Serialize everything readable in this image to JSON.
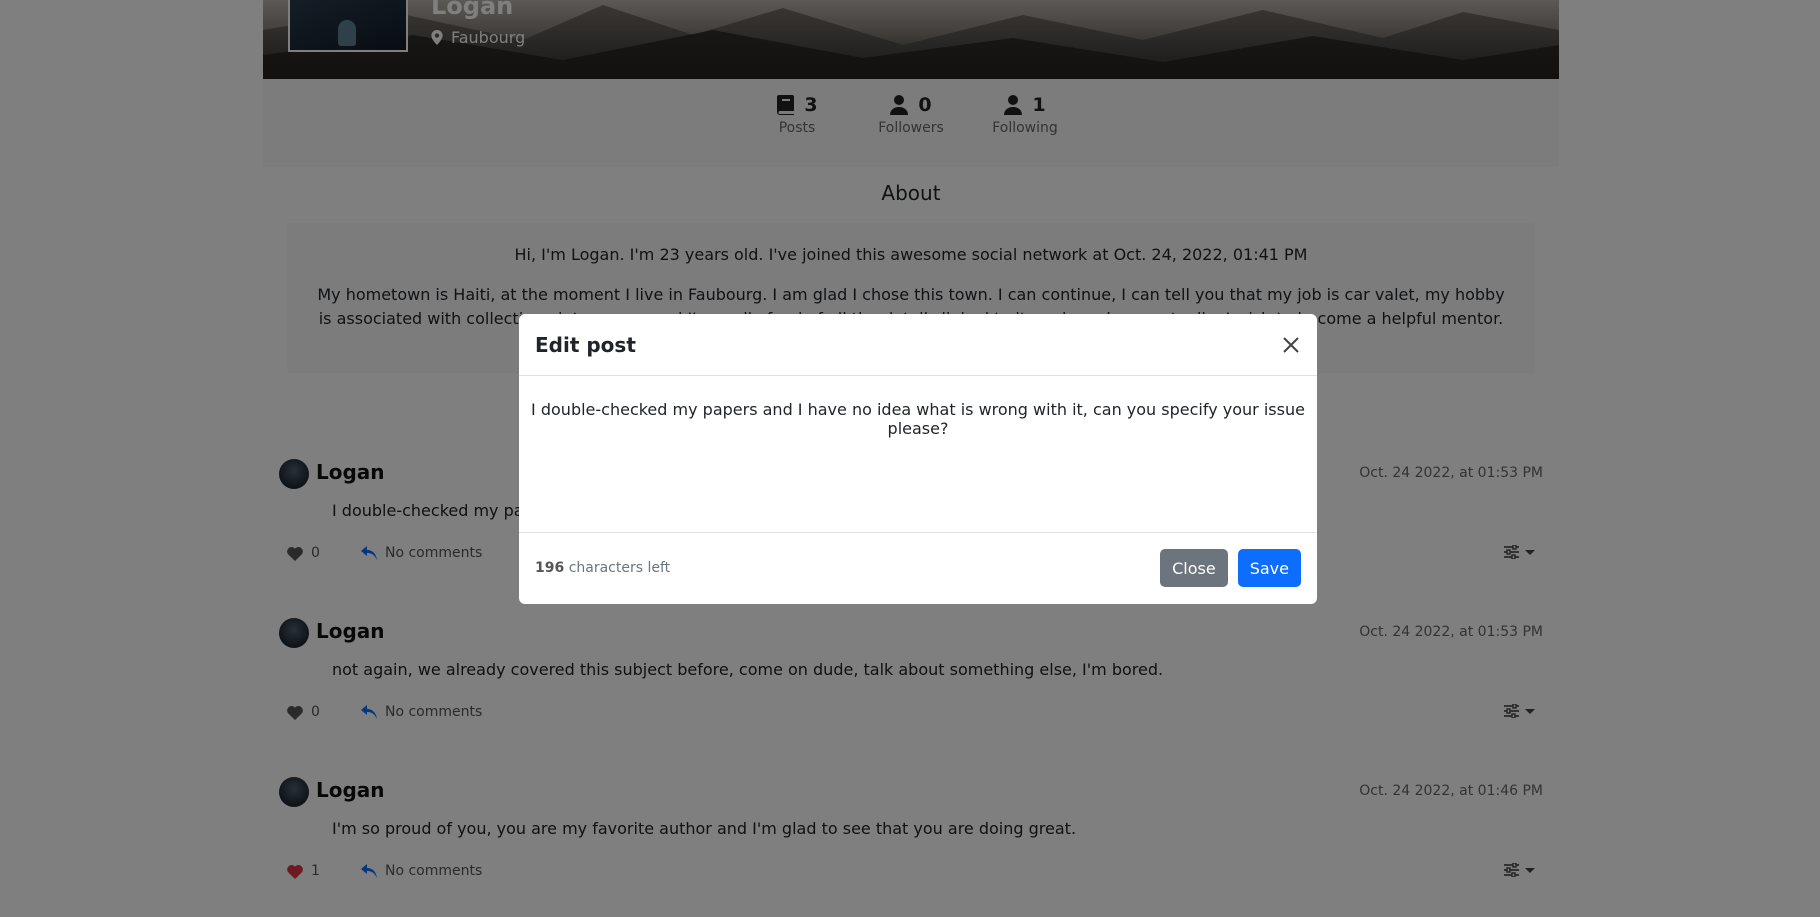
{
  "profile": {
    "name": "Logan",
    "location": "Faubourg",
    "stats": [
      {
        "count": "3",
        "label": "Posts",
        "icon": "book-icon"
      },
      {
        "count": "0",
        "label": "Followers",
        "icon": "user-icon"
      },
      {
        "count": "1",
        "label": "Following",
        "icon": "user-icon"
      }
    ],
    "about_heading": "About",
    "about_line1": "Hi, I'm Logan. I'm 23 years old. I've joined this awesome social network at Oct. 24, 2022, 01:41 PM",
    "about_line2": "My hometown is Haiti, at the moment I live in Faubourg. I am glad I chose this town. I can continue, I can tell you that my job is car valet, my hobby is associated with collecting vintage cars and I'm really fond of all the details linked to it, and maybe eventually, I wish to become a helpful mentor."
  },
  "posts": [
    {
      "author": "Logan",
      "date": "Oct. 24 2022, at 01:53 PM",
      "body": "I double-checked my papers and I have no idea what is wrong with it, can you specify your issue please?",
      "likes": "0",
      "liked": false,
      "comments": "No comments"
    },
    {
      "author": "Logan",
      "date": "Oct. 24 2022, at 01:53 PM",
      "body": "not again, we already covered this subject before, come on dude, talk about something else, I'm bored.",
      "likes": "0",
      "liked": false,
      "comments": "No comments"
    },
    {
      "author": "Logan",
      "date": "Oct. 24 2022, at 01:46 PM",
      "body": "I'm so proud of you, you are my favorite author and I'm glad to see that you are doing great.",
      "likes": "1",
      "liked": true,
      "comments": "No comments"
    }
  ],
  "modal": {
    "title": "Edit post",
    "text": "I double-checked my papers and I have no idea what is wrong with it, can you specify your issue please?",
    "chars_left": "196",
    "chars_left_suffix": "characters left",
    "close_label": "Close",
    "save_label": "Save"
  },
  "colors": {
    "primary": "#0d6efd",
    "secondary": "#6c757d",
    "liked": "#dc3545"
  }
}
